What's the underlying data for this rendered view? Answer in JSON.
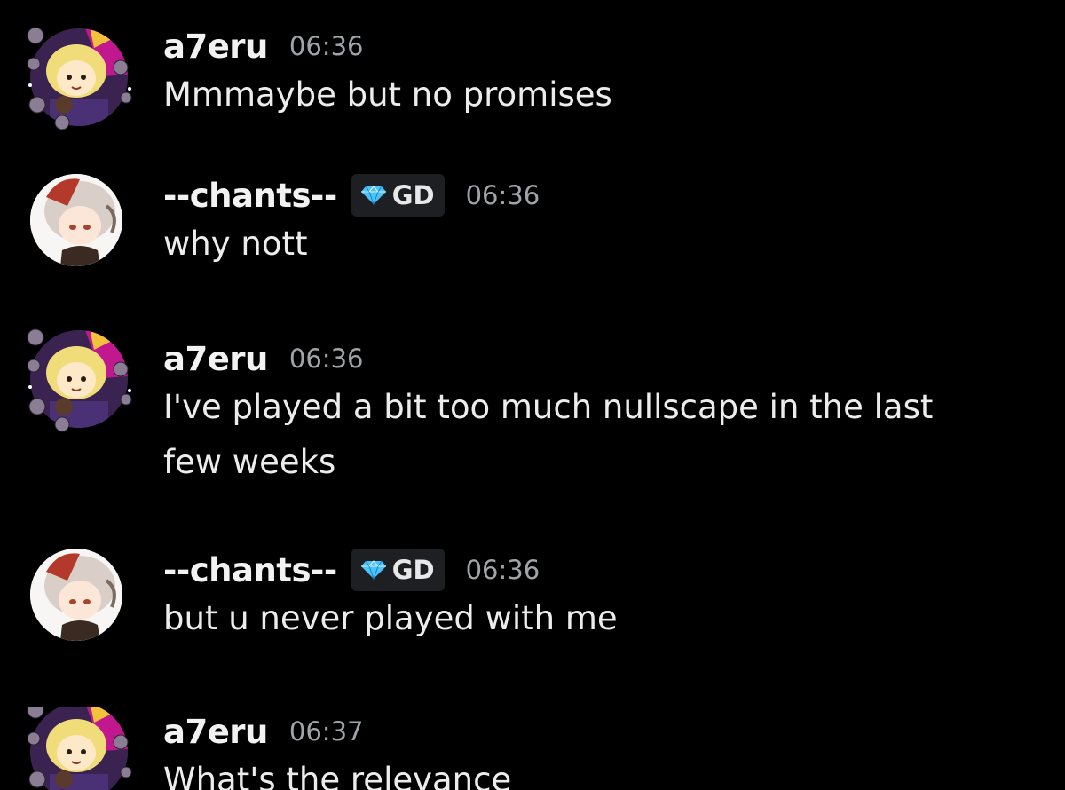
{
  "messages": [
    {
      "user": "a7eru",
      "avatar": "a7eru-avatar",
      "badge": null,
      "time": "06:36",
      "text": "Mmmaybe but no promises"
    },
    {
      "user": "--chants--",
      "avatar": "chants-avatar",
      "badge": {
        "icon": "diamond-icon",
        "label": "GD"
      },
      "time": "06:36",
      "text": "why nott"
    },
    {
      "user": "a7eru",
      "avatar": "a7eru-avatar",
      "badge": null,
      "time": "06:36",
      "text": "I've played a bit too much nullscape in the last few weeks"
    },
    {
      "user": "--chants--",
      "avatar": "chants-avatar",
      "badge": {
        "icon": "diamond-icon",
        "label": "GD"
      },
      "time": "06:36",
      "text": "but u never played with me"
    },
    {
      "user": "a7eru",
      "avatar": "a7eru-avatar",
      "badge": null,
      "time": "06:37",
      "text": "What's the relevance"
    }
  ],
  "colors": {
    "background": "#000000",
    "username": "#f2f2f2",
    "timestamp": "#a0a3a8",
    "message_text": "#ececec",
    "badge_bg": "#1e1f22",
    "badge_icon": "#4fc3f7"
  }
}
